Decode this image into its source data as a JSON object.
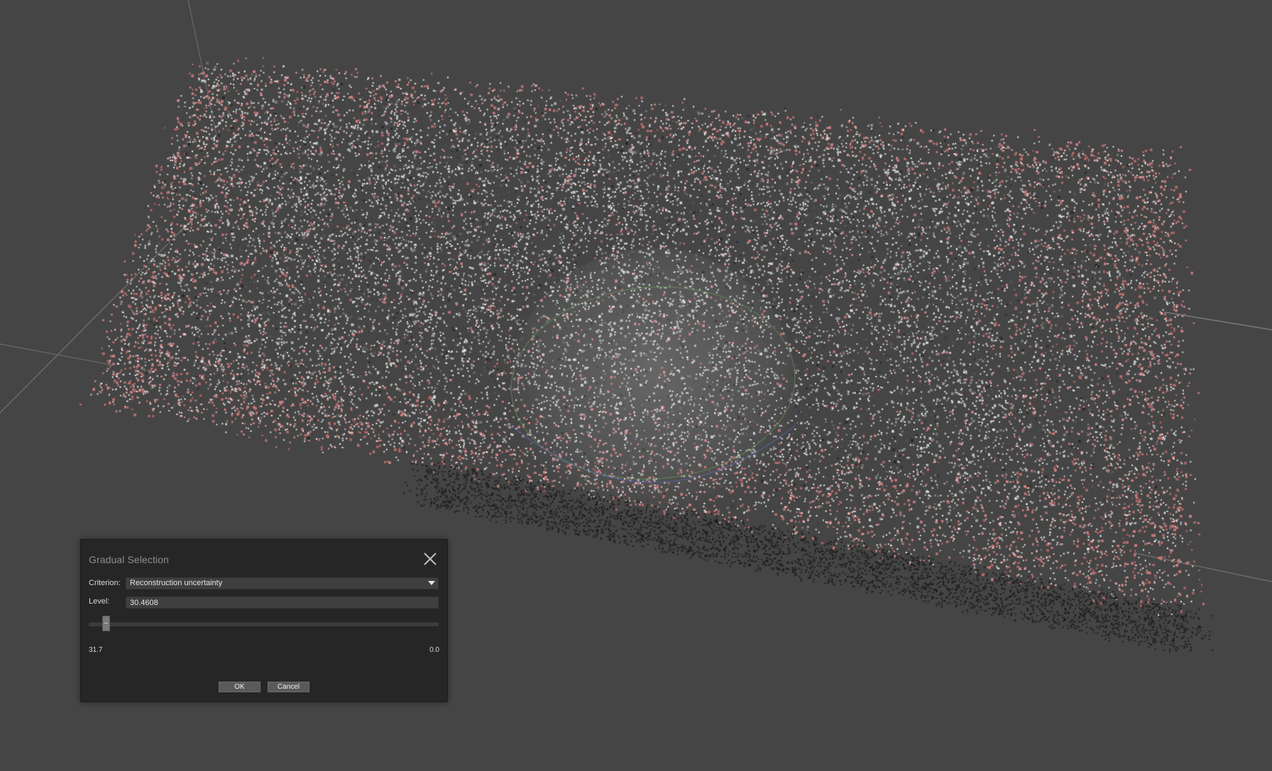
{
  "dialog": {
    "title": "Gradual Selection",
    "criterion_label": "Criterion:",
    "criterion_value": "Reconstruction uncertainty",
    "level_label": "Level:",
    "level_value": "30.4608",
    "slider": {
      "min_label": "31.7",
      "max_label": "0.0"
    },
    "ok_label": "OK",
    "cancel_label": "Cancel"
  },
  "colors": {
    "viewport_background": "#454545",
    "selected_points": "#c88a8a",
    "unselected_points": "#9a9a9a",
    "dialog_background": "#262626"
  },
  "icons": {
    "close": "close-icon",
    "dropdown": "chevron-down-icon"
  }
}
